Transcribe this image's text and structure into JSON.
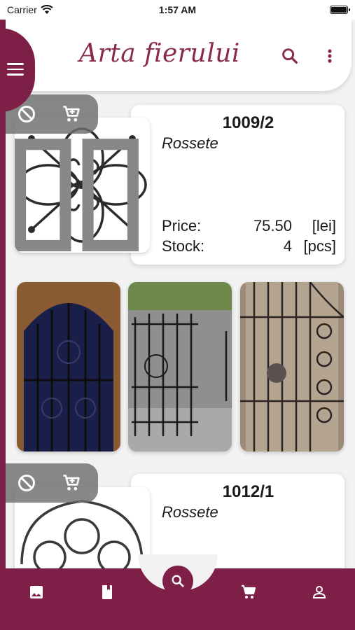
{
  "status_bar": {
    "carrier": "Carrier",
    "time": "1:57 AM"
  },
  "header": {
    "brand": "Arta fierului"
  },
  "products": [
    {
      "code": "1009/2",
      "name": "Rossete",
      "price_label": "Price:",
      "price": "75.50",
      "price_unit": "[lei]",
      "stock_label": "Stock:",
      "stock": "4",
      "stock_unit": "[pcs]"
    },
    {
      "code": "1012/1",
      "name": "Rossete"
    }
  ],
  "bottom_nav": {
    "items": [
      "gallery-icon",
      "catalog-icon",
      "search-icon",
      "cart-icon",
      "account-icon"
    ]
  },
  "colors": {
    "accent": "#7d1f47",
    "brand_text": "#8a2a4e",
    "background": "#f2f2f2"
  }
}
